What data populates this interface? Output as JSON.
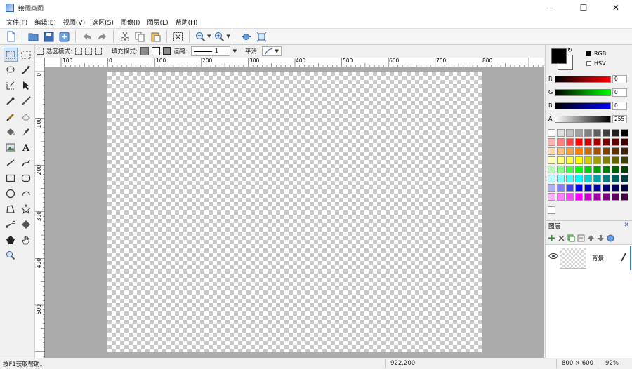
{
  "window": {
    "title": "绘图画图",
    "min": "—",
    "max": "☐",
    "close": "✕"
  },
  "menu": [
    "文件(F)",
    "编辑(E)",
    "视图(V)",
    "选区(S)",
    "图像(I)",
    "图层(L)",
    "帮助(H)"
  ],
  "options": {
    "select_mode_label": "选区模式:",
    "fill_mode_label": "填充模式:",
    "brush_label": "画笔:",
    "brush_width": "1",
    "antialias_label": "平滑:"
  },
  "rulers": {
    "h_labels": [
      "100",
      "0",
      "100",
      "200",
      "300",
      "400",
      "500",
      "600",
      "700",
      "800"
    ],
    "v_labels": [
      "0",
      "100",
      "200",
      "300",
      "400",
      "500"
    ]
  },
  "color": {
    "mode_rgb": "RGB",
    "mode_hsv": "HSV",
    "r_label": "R",
    "g_label": "G",
    "b_label": "B",
    "a_label": "A",
    "r_value": "0",
    "g_value": "0",
    "b_value": "0",
    "a_value": "255",
    "primary": "#000000",
    "secondary": "#ffffff"
  },
  "palette": [
    [
      "#ffffff",
      "#e0e0e0",
      "#c0c0c0",
      "#a0a0a0",
      "#808080",
      "#606060",
      "#404040",
      "#202020",
      "#000000"
    ],
    [
      "#ffb0b0",
      "#ff8080",
      "#ff4040",
      "#ff0000",
      "#d00000",
      "#a00000",
      "#800000",
      "#600000",
      "#400000"
    ],
    [
      "#ffd8b0",
      "#ffc080",
      "#ffa040",
      "#ff8000",
      "#d06800",
      "#a05000",
      "#804000",
      "#603000",
      "#402000"
    ],
    [
      "#ffffb0",
      "#ffff80",
      "#ffff40",
      "#ffff00",
      "#d0d000",
      "#a0a000",
      "#808000",
      "#606000",
      "#404000"
    ],
    [
      "#b0ffb0",
      "#80ff80",
      "#40ff40",
      "#00ff00",
      "#00d000",
      "#00a000",
      "#008000",
      "#006000",
      "#004000"
    ],
    [
      "#b0ffff",
      "#80ffff",
      "#40ffff",
      "#00ffff",
      "#00d0d0",
      "#00a0a0",
      "#008080",
      "#006060",
      "#004040"
    ],
    [
      "#b0b0ff",
      "#8080ff",
      "#4040ff",
      "#0000ff",
      "#0000d0",
      "#0000a0",
      "#000080",
      "#000060",
      "#000040"
    ],
    [
      "#ffb0ff",
      "#ff80ff",
      "#ff40ff",
      "#ff00ff",
      "#d000d0",
      "#a000a0",
      "#800080",
      "#600060",
      "#400040"
    ]
  ],
  "layers": {
    "title": "图层",
    "items": [
      {
        "name": "背景"
      }
    ]
  },
  "status": {
    "hint": "按F1获取帮助。",
    "coords": "922,200",
    "size": "800 × 600",
    "zoom": "92%"
  }
}
